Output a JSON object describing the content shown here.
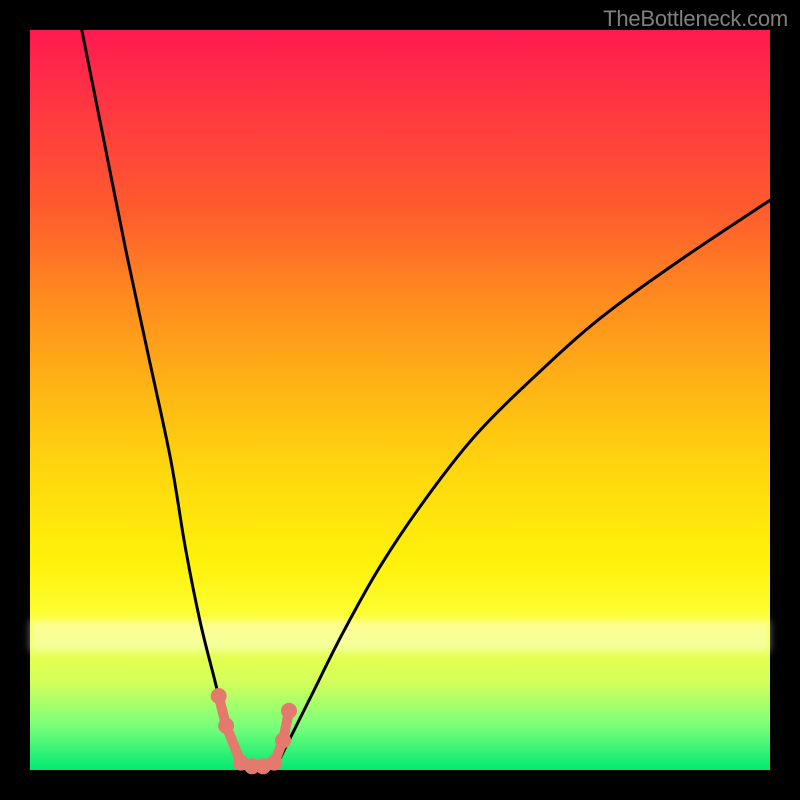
{
  "watermark": "TheBottleneck.com",
  "colors": {
    "bg": "#000000",
    "gradient_top": "#ff1a51",
    "gradient_bottom": "#00e973",
    "curve": "#000000",
    "markers": "#e37a6d"
  },
  "chart_data": {
    "type": "line",
    "title": "",
    "xlabel": "",
    "ylabel": "",
    "xlim": [
      0,
      100
    ],
    "ylim": [
      0,
      100
    ],
    "series": [
      {
        "name": "left-curve",
        "x": [
          7,
          10,
          13,
          16,
          19,
          21,
          23,
          25,
          26.5,
          28,
          29.5
        ],
        "values": [
          100,
          85,
          70,
          56,
          42,
          30,
          20,
          12,
          6,
          2,
          0
        ]
      },
      {
        "name": "right-curve",
        "x": [
          33,
          35,
          38,
          42,
          47,
          53,
          60,
          68,
          77,
          88,
          100
        ],
        "values": [
          0,
          4,
          10,
          18,
          27,
          36,
          45,
          53,
          61,
          69,
          77
        ]
      }
    ],
    "markers": {
      "name": "bottleneck-zone",
      "x": [
        25.5,
        26.5,
        28.5,
        30,
        31.5,
        33,
        34.2,
        35
      ],
      "values": [
        10,
        6,
        1,
        0.5,
        0.5,
        1,
        4,
        8
      ]
    }
  }
}
